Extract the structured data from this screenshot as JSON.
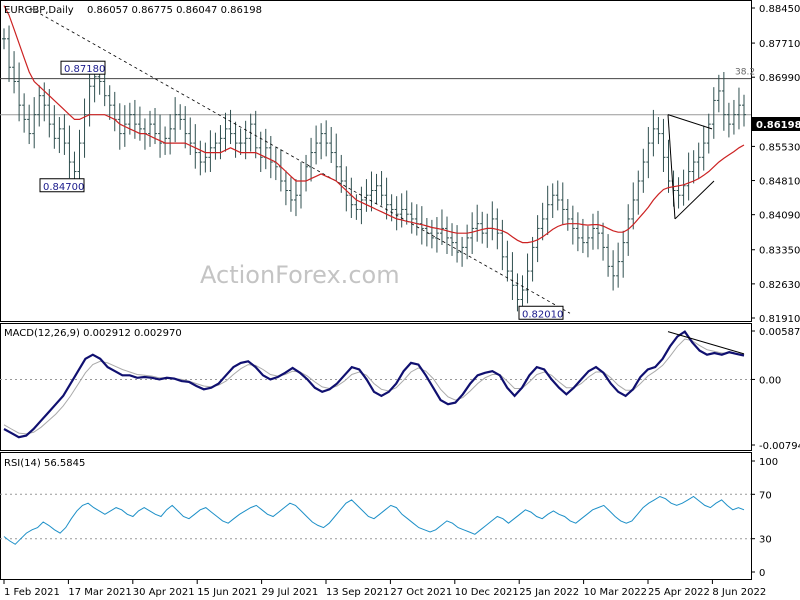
{
  "chart_data": {
    "type": "line",
    "title": "EURGBP,Daily",
    "ohlc_header": "0.86057 0.86775 0.86047 0.86198",
    "watermark": "ActionForex.com",
    "x_ticks": [
      "1 Feb 2021",
      "17 Mar 2021",
      "30 Apr 2021",
      "15 Jun 2021",
      "29 Jul 2021",
      "13 Sep 2021",
      "27 Oct 2021",
      "10 Dec 2021",
      "25 Jan 2022",
      "10 Mar 2022",
      "25 Apr 2022",
      "8 Jun 2022"
    ],
    "price_pane": {
      "y_ticks": [
        "0.88450",
        "0.87710",
        "0.86990",
        "0.85530",
        "0.84810",
        "0.84090",
        "0.83350",
        "0.82630",
        "0.81910"
      ],
      "ylim": [
        0.8191,
        0.8845
      ],
      "last_price_label": "0.86198",
      "last_price": 0.86198,
      "annotations": [
        {
          "text": "0.87180",
          "value": 0.8718
        },
        {
          "text": "0.84700",
          "value": 0.847
        },
        {
          "text": "0.82010",
          "value": 0.8201
        }
      ],
      "fib_line": {
        "text": "38.2",
        "value": 0.8696
      },
      "close": [
        0.878,
        0.872,
        0.869,
        0.864,
        0.861,
        0.858,
        0.862,
        0.866,
        0.864,
        0.86,
        0.857,
        0.859,
        0.856,
        0.852,
        0.85,
        0.856,
        0.862,
        0.868,
        0.87,
        0.869,
        0.866,
        0.864,
        0.861,
        0.858,
        0.86,
        0.862,
        0.86,
        0.859,
        0.858,
        0.86,
        0.858,
        0.856,
        0.857,
        0.859,
        0.862,
        0.861,
        0.858,
        0.856,
        0.854,
        0.852,
        0.853,
        0.855,
        0.856,
        0.857,
        0.859,
        0.858,
        0.856,
        0.856,
        0.857,
        0.86,
        0.855,
        0.853,
        0.855,
        0.852,
        0.851,
        0.848,
        0.846,
        0.844,
        0.845,
        0.848,
        0.851,
        0.854,
        0.856,
        0.858,
        0.856,
        0.854,
        0.851,
        0.848,
        0.845,
        0.843,
        0.842,
        0.844,
        0.845,
        0.846,
        0.847,
        0.845,
        0.843,
        0.842,
        0.841,
        0.842,
        0.841,
        0.84,
        0.839,
        0.838,
        0.837,
        0.836,
        0.837,
        0.838,
        0.836,
        0.835,
        0.833,
        0.834,
        0.836,
        0.838,
        0.839,
        0.837,
        0.838,
        0.84,
        0.837,
        0.832,
        0.829,
        0.826,
        0.823,
        0.825,
        0.829,
        0.834,
        0.838,
        0.84,
        0.843,
        0.845,
        0.844,
        0.842,
        0.84,
        0.838,
        0.836,
        0.835,
        0.836,
        0.838,
        0.837,
        0.834,
        0.83,
        0.828,
        0.831,
        0.835,
        0.84,
        0.844,
        0.848,
        0.852,
        0.856,
        0.859,
        0.858,
        0.853,
        0.848,
        0.846,
        0.845,
        0.847,
        0.85,
        0.852,
        0.853,
        0.856,
        0.86,
        0.865,
        0.867,
        0.862,
        0.86,
        0.862,
        0.864,
        0.862
      ],
      "ma": [
        0.885,
        0.883,
        0.88,
        0.877,
        0.874,
        0.871,
        0.869,
        0.868,
        0.867,
        0.866,
        0.865,
        0.864,
        0.863,
        0.862,
        0.861,
        0.861,
        0.8615,
        0.862,
        0.862,
        0.862,
        0.862,
        0.8615,
        0.861,
        0.86,
        0.8595,
        0.859,
        0.8585,
        0.858,
        0.858,
        0.8575,
        0.857,
        0.8565,
        0.856,
        0.856,
        0.856,
        0.856,
        0.856,
        0.8555,
        0.855,
        0.8545,
        0.854,
        0.854,
        0.854,
        0.854,
        0.8545,
        0.855,
        0.8545,
        0.854,
        0.854,
        0.854,
        0.854,
        0.8535,
        0.853,
        0.8525,
        0.852,
        0.851,
        0.85,
        0.849,
        0.848,
        0.848,
        0.848,
        0.8485,
        0.849,
        0.8495,
        0.849,
        0.8485,
        0.848,
        0.847,
        0.846,
        0.845,
        0.844,
        0.8435,
        0.843,
        0.8425,
        0.842,
        0.8415,
        0.841,
        0.8405,
        0.84,
        0.8398,
        0.8395,
        0.8393,
        0.839,
        0.8388,
        0.8385,
        0.8382,
        0.838,
        0.8378,
        0.8375,
        0.8372,
        0.837,
        0.837,
        0.837,
        0.8372,
        0.8375,
        0.8378,
        0.838,
        0.838,
        0.8378,
        0.8375,
        0.837,
        0.8362,
        0.8355,
        0.835,
        0.835,
        0.8352,
        0.8356,
        0.8362,
        0.837,
        0.8378,
        0.8384,
        0.8388,
        0.839,
        0.839,
        0.839,
        0.8388,
        0.8387,
        0.8388,
        0.8388,
        0.8385,
        0.838,
        0.8375,
        0.8372,
        0.8372,
        0.8378,
        0.8388,
        0.84,
        0.8412,
        0.8425,
        0.844,
        0.8452,
        0.8462,
        0.8466,
        0.8468,
        0.847,
        0.8472,
        0.8476,
        0.848,
        0.8485,
        0.8492,
        0.85,
        0.851,
        0.852,
        0.8528,
        0.8535,
        0.8542,
        0.855,
        0.8556
      ]
    },
    "macd_pane": {
      "label": "MACD(12,26,9) 0.002912 0.002970",
      "y_ticks": [
        "0.005872",
        "0.00",
        "-0.007945"
      ],
      "ylim": [
        -0.007945,
        0.005872
      ],
      "macd": [
        -0.006,
        -0.0065,
        -0.007,
        -0.0068,
        -0.006,
        -0.005,
        -0.004,
        -0.003,
        -0.002,
        -0.0005,
        0.001,
        0.0025,
        0.003,
        0.0025,
        0.0015,
        0.001,
        0.0005,
        0.0005,
        0.0002,
        0.0003,
        0.0002,
        0.0,
        0.0002,
        0.0001,
        -0.0002,
        -0.0003,
        -0.0008,
        -0.0012,
        -0.001,
        -0.0005,
        0.0005,
        0.0015,
        0.002,
        0.0022,
        0.0015,
        0.0005,
        0.0,
        0.0003,
        0.0008,
        0.0014,
        0.0008,
        0.0,
        -0.001,
        -0.0015,
        -0.0012,
        -0.0005,
        0.0005,
        0.0015,
        0.0012,
        0.0,
        -0.0015,
        -0.002,
        -0.0015,
        -0.0005,
        0.001,
        0.002,
        0.0018,
        0.0005,
        -0.001,
        -0.0025,
        -0.003,
        -0.0028,
        -0.0018,
        -0.0005,
        0.0005,
        0.0008,
        0.001,
        0.0005,
        -0.001,
        -0.002,
        -0.001,
        0.0005,
        0.0015,
        0.0012,
        0.0,
        -0.001,
        -0.0018,
        -0.001,
        0.0,
        0.001,
        0.0015,
        0.0008,
        -0.0005,
        -0.0015,
        -0.002,
        -0.0012,
        0.0003,
        0.0012,
        0.0015,
        0.0025,
        0.004,
        0.0052,
        0.0058,
        0.0045,
        0.0035,
        0.003,
        0.0032,
        0.003,
        0.0033,
        0.0031,
        0.0029
      ],
      "signal": [
        -0.0055,
        -0.006,
        -0.0065,
        -0.0066,
        -0.0064,
        -0.0058,
        -0.005,
        -0.0042,
        -0.0032,
        -0.002,
        -0.0006,
        0.0008,
        0.0018,
        0.0022,
        0.002,
        0.0016,
        0.0012,
        0.0009,
        0.0006,
        0.0005,
        0.0004,
        0.0002,
        0.0002,
        0.0001,
        0.0,
        -0.0002,
        -0.0005,
        -0.0008,
        -0.0009,
        -0.0007,
        -0.0002,
        0.0006,
        0.0013,
        0.0018,
        0.0017,
        0.0012,
        0.0006,
        0.0004,
        0.0006,
        0.001,
        0.0009,
        0.0004,
        -0.0003,
        -0.0009,
        -0.0011,
        -0.0008,
        -0.0002,
        0.0006,
        0.0009,
        0.0005,
        -0.0005,
        -0.0012,
        -0.0014,
        -0.001,
        -0.0001,
        0.0009,
        0.0014,
        0.001,
        0.0001,
        -0.0012,
        -0.0021,
        -0.0025,
        -0.0022,
        -0.0014,
        -0.0005,
        0.0002,
        0.0006,
        0.0006,
        -0.0002,
        -0.0011,
        -0.0011,
        -0.0003,
        0.0006,
        0.0009,
        0.0005,
        -0.0003,
        -0.001,
        -0.001,
        -0.0005,
        0.0003,
        0.0009,
        0.0009,
        0.0002,
        -0.0007,
        -0.0013,
        -0.0013,
        -0.0005,
        0.0004,
        0.001,
        0.0017,
        0.0028,
        0.004,
        0.0049,
        0.0047,
        0.0041,
        0.0036,
        0.0034,
        0.0032,
        0.0032,
        0.0031,
        0.003
      ]
    },
    "rsi_pane": {
      "label": "RSI(14) 56.5845",
      "y_ticks": [
        "100",
        "70",
        "30",
        "0"
      ],
      "ylim": [
        0,
        100
      ],
      "levels": [
        70,
        30
      ],
      "values": [
        32,
        28,
        25,
        30,
        35,
        38,
        40,
        45,
        42,
        38,
        35,
        40,
        48,
        55,
        60,
        62,
        58,
        55,
        52,
        55,
        58,
        56,
        52,
        50,
        55,
        58,
        55,
        52,
        50,
        56,
        60,
        55,
        50,
        48,
        52,
        56,
        58,
        54,
        50,
        46,
        44,
        48,
        52,
        55,
        58,
        60,
        56,
        52,
        50,
        54,
        58,
        62,
        60,
        55,
        50,
        45,
        42,
        40,
        44,
        50,
        56,
        62,
        65,
        60,
        55,
        50,
        48,
        52,
        56,
        60,
        58,
        52,
        48,
        44,
        40,
        38,
        36,
        38,
        42,
        46,
        44,
        40,
        38,
        36,
        34,
        38,
        42,
        46,
        50,
        48,
        44,
        48,
        52,
        56,
        54,
        50,
        48,
        52,
        55,
        52,
        50,
        46,
        44,
        48,
        52,
        56,
        58,
        60,
        55,
        50,
        46,
        44,
        46,
        52,
        58,
        62,
        65,
        68,
        66,
        62,
        60,
        62,
        65,
        68,
        64,
        60,
        58,
        62,
        65,
        60,
        56,
        58,
        56
      ]
    }
  }
}
